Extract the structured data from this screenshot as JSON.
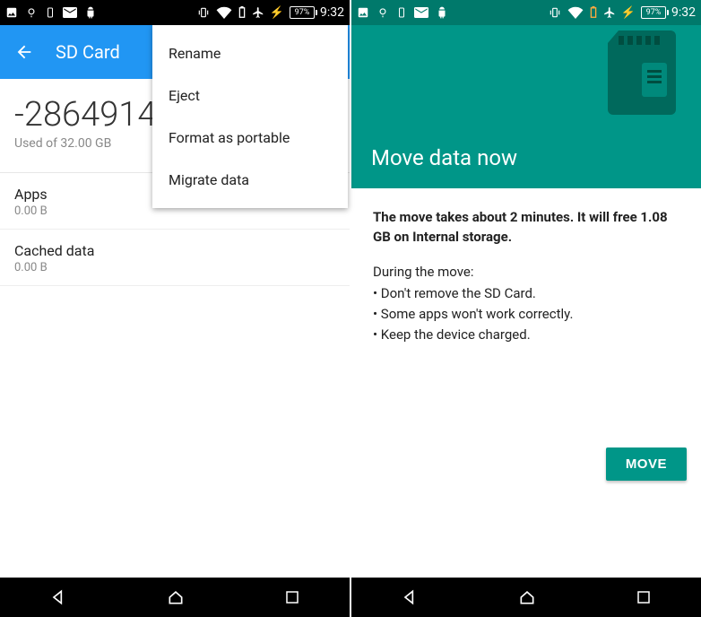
{
  "status": {
    "battery_pct": "97%",
    "clock": "9:32"
  },
  "left": {
    "appbar_title": "SD Card",
    "storage_value": "-2864914",
    "storage_sub": "Used of 32.00 GB",
    "rows": [
      {
        "primary": "Apps",
        "secondary": "0.00 B"
      },
      {
        "primary": "Cached data",
        "secondary": "0.00 B"
      }
    ],
    "menu": [
      "Rename",
      "Eject",
      "Format as portable",
      "Migrate data"
    ]
  },
  "right": {
    "hero_title": "Move data now",
    "bold_line": "The move takes about 2 minutes. It will free 1.08 GB on Internal storage.",
    "during_title": "During the move:",
    "bullets": [
      "• Don't remove the SD Card.",
      "• Some apps won't work correctly.",
      "• Keep the device charged."
    ],
    "button": "MOVE"
  }
}
